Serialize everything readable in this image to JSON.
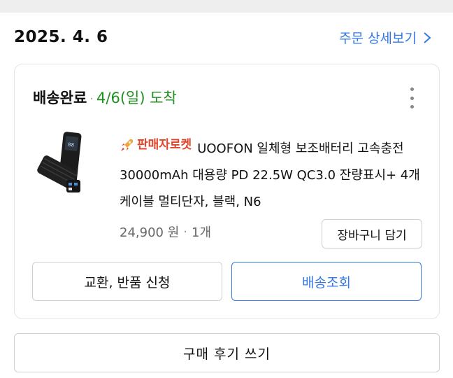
{
  "order": {
    "date": "2025. 4. 6",
    "detail_link_label": "주문 상세보기"
  },
  "delivery": {
    "status": "배송완료",
    "separator": "·",
    "arrival": "4/6(일) 도착",
    "status_color": "#1f8f1f"
  },
  "product": {
    "badge_label": "판매자로켓",
    "badge_color": "#e2442a",
    "title": "UOOFON 일체형 보조배터리 고속충전 30000mAh 대용량 PD 22.5W QC3.0 잔량표시+ 4개 케이블 멀티단자, 블랙, N6",
    "price": "24,900 원",
    "quantity": "1개",
    "image_icon": "power-bank-image"
  },
  "buttons": {
    "cart": "장바구니 담기",
    "exchange": "교환, 반품 신청",
    "track": "배송조회",
    "review": "구매 후기 쓰기"
  },
  "colors": {
    "accent": "#3478e5",
    "delivered": "#1f8f1f",
    "rocket": "#e2442a"
  }
}
